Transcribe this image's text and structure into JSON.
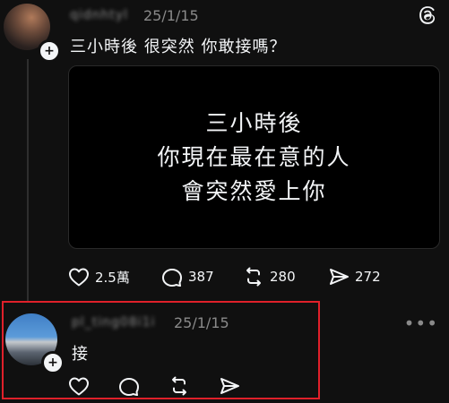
{
  "post": {
    "username": "qidnhtyl",
    "time": "25/1/15",
    "text": "三小時後  很突然  你敢接嗎？",
    "media_lines": [
      "三小時後",
      "你現在最在意的人",
      "會突然愛上你"
    ],
    "likes": "2.5萬",
    "comments": "387",
    "reposts": "280",
    "shares": "272"
  },
  "reply": {
    "username": "pl_ting08i1i",
    "time": "25/1/15",
    "text": "接",
    "more": "•••"
  },
  "icons": {
    "add": "plus-icon",
    "logo": "threads-logo-icon",
    "like": "heart-icon",
    "comment": "comment-icon",
    "repost": "repost-icon",
    "share": "send-icon"
  },
  "colors": {
    "background": "#101010",
    "highlight_border": "#e0202a",
    "muted_text": "#8a8a8a"
  }
}
